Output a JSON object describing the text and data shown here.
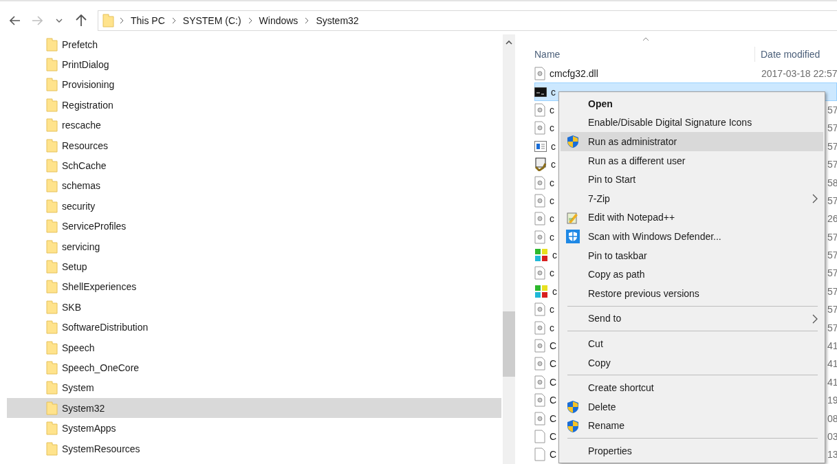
{
  "toolbar": {
    "back_disabled": false,
    "forward_disabled": true,
    "breadcrumb": [
      "This PC",
      "SYSTEM (C:)",
      "Windows",
      "System32"
    ]
  },
  "folder_tree": [
    {
      "label": "Prefetch",
      "selected": false
    },
    {
      "label": "PrintDialog",
      "selected": false
    },
    {
      "label": "Provisioning",
      "selected": false
    },
    {
      "label": "Registration",
      "selected": false
    },
    {
      "label": "rescache",
      "selected": false
    },
    {
      "label": "Resources",
      "selected": false
    },
    {
      "label": "SchCache",
      "selected": false
    },
    {
      "label": "schemas",
      "selected": false
    },
    {
      "label": "security",
      "selected": false
    },
    {
      "label": "ServiceProfiles",
      "selected": false
    },
    {
      "label": "servicing",
      "selected": false
    },
    {
      "label": "Setup",
      "selected": false
    },
    {
      "label": "ShellExperiences",
      "selected": false
    },
    {
      "label": "SKB",
      "selected": false
    },
    {
      "label": "SoftwareDistribution",
      "selected": false
    },
    {
      "label": "Speech",
      "selected": false
    },
    {
      "label": "Speech_OneCore",
      "selected": false
    },
    {
      "label": "System",
      "selected": false
    },
    {
      "label": "System32",
      "selected": true
    },
    {
      "label": "SystemApps",
      "selected": false
    },
    {
      "label": "SystemResources",
      "selected": false
    }
  ],
  "file_list": {
    "columns": [
      "Name",
      "Date modified"
    ],
    "rows": [
      {
        "kind": "dll",
        "name": "cmcfg32.dll",
        "date": "2017-03-18 22:57",
        "selected": false
      },
      {
        "kind": "console",
        "name": "c",
        "selected": true
      },
      {
        "kind": "dll",
        "name": "c",
        "date": "57",
        "selected": false
      },
      {
        "kind": "dll",
        "name": "c",
        "date": "57",
        "selected": false
      },
      {
        "kind": "window",
        "name": "c",
        "date": "57",
        "selected": false
      },
      {
        "kind": "installer",
        "name": "c",
        "date": "57",
        "selected": false
      },
      {
        "kind": "dll",
        "name": "c",
        "date": "58",
        "selected": false
      },
      {
        "kind": "dll",
        "name": "c",
        "date": "57",
        "selected": false
      },
      {
        "kind": "dll",
        "name": "c",
        "date": "26",
        "selected": false
      },
      {
        "kind": "dll",
        "name": "c",
        "date": "57",
        "selected": false
      },
      {
        "kind": "puzzle",
        "name": "c",
        "date": "57",
        "selected": false
      },
      {
        "kind": "dll",
        "name": "c",
        "date": "57",
        "selected": false
      },
      {
        "kind": "puzzle",
        "name": "c",
        "date": "57",
        "selected": false
      },
      {
        "kind": "dll",
        "name": "c",
        "date": "57",
        "selected": false
      },
      {
        "kind": "dll",
        "name": "c",
        "date": "57",
        "selected": false
      },
      {
        "kind": "dll",
        "name": "C",
        "date": "41",
        "selected": false
      },
      {
        "kind": "dll",
        "name": "C",
        "date": "41",
        "selected": false
      },
      {
        "kind": "dll",
        "name": "C",
        "date": "41",
        "selected": false
      },
      {
        "kind": "dll",
        "name": "C",
        "date": "19",
        "selected": false
      },
      {
        "kind": "dll",
        "name": "C",
        "date": "08",
        "selected": false
      },
      {
        "kind": "blank",
        "name": "C",
        "date": "03",
        "selected": false
      },
      {
        "kind": "blank",
        "name": "C",
        "date": "13",
        "selected": false
      }
    ]
  },
  "context_menu": [
    {
      "kind": "plain",
      "label": "Open",
      "default": true,
      "submenu": false,
      "selected": false
    },
    {
      "kind": "plain",
      "label": "Enable/Disable Digital Signature Icons",
      "default": false,
      "submenu": false,
      "selected": false
    },
    {
      "kind": "shield",
      "label": "Run as administrator",
      "default": false,
      "submenu": false,
      "selected": true
    },
    {
      "kind": "plain",
      "label": "Run as a different user",
      "default": false,
      "submenu": false,
      "selected": false
    },
    {
      "kind": "plain",
      "label": "Pin to Start",
      "default": false,
      "submenu": false,
      "selected": false
    },
    {
      "kind": "plain",
      "label": "7-Zip",
      "default": false,
      "submenu": true,
      "selected": false
    },
    {
      "kind": "notepad",
      "label": "Edit with Notepad++",
      "default": false,
      "submenu": false,
      "selected": false
    },
    {
      "kind": "defender",
      "label": "Scan with Windows Defender...",
      "default": false,
      "submenu": false,
      "selected": false
    },
    {
      "kind": "plain",
      "label": "Pin to taskbar",
      "default": false,
      "submenu": false,
      "selected": false
    },
    {
      "kind": "plain",
      "label": "Copy as path",
      "default": false,
      "submenu": false,
      "selected": false
    },
    {
      "kind": "plain",
      "label": "Restore previous versions",
      "default": false,
      "submenu": false,
      "selected": false
    },
    {
      "kind": "separator"
    },
    {
      "kind": "plain",
      "label": "Send to",
      "default": false,
      "submenu": true,
      "selected": false
    },
    {
      "kind": "separator"
    },
    {
      "kind": "plain",
      "label": "Cut",
      "default": false,
      "submenu": false,
      "selected": false
    },
    {
      "kind": "plain",
      "label": "Copy",
      "default": false,
      "submenu": false,
      "selected": false
    },
    {
      "kind": "separator"
    },
    {
      "kind": "plain",
      "label": "Create shortcut",
      "default": false,
      "submenu": false,
      "selected": false
    },
    {
      "kind": "shield",
      "label": "Delete",
      "default": false,
      "submenu": false,
      "selected": false
    },
    {
      "kind": "shield",
      "label": "Rename",
      "default": false,
      "submenu": false,
      "selected": false
    },
    {
      "kind": "separator"
    },
    {
      "kind": "plain",
      "label": "Properties",
      "default": false,
      "submenu": false,
      "selected": false
    }
  ]
}
